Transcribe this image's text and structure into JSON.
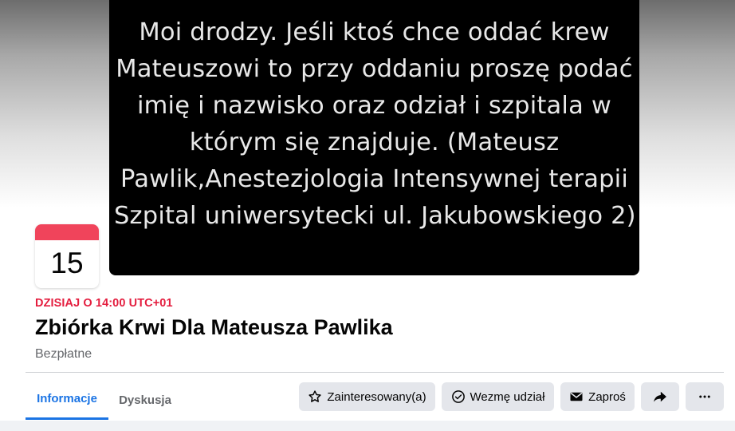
{
  "cover": {
    "lines": [
      "Moi drodzy. Jeśli ktoś chce oddać krew",
      "Mateuszowi to przy oddaniu proszę podać",
      "imię i nazwisko oraz odział i szpitala w",
      "którym się znajduje. (Mateusz",
      "Pawlik,Anestezjologia Intensywnej terapii",
      "Szpital uniwersytecki ul. Jakubowskiego 2)"
    ]
  },
  "date_card": {
    "day": "15",
    "accent": "#f0445b"
  },
  "event": {
    "time": "DZISIAJ O 14:00 UTC+01",
    "title": "Zbiórka Krwi Dla Mateusza Pawlika",
    "price": "Bezpłatne"
  },
  "tabs": [
    {
      "label": "Informacje",
      "active": true
    },
    {
      "label": "Dyskusja",
      "active": false
    }
  ],
  "actions": {
    "interested": {
      "label": "Zainteresowany(a)",
      "icon": "star-icon"
    },
    "going": {
      "label": "Wezmę udział",
      "icon": "check-circle-icon"
    },
    "invite": {
      "label": "Zaproś",
      "icon": "envelope-icon"
    },
    "share": {
      "icon": "share-arrow-icon"
    },
    "more": {
      "icon": "more-dots-icon"
    }
  },
  "colors": {
    "accent_blue": "#1b74e4",
    "time_red": "#e41e3f",
    "button_gray": "#e4e6eb"
  }
}
